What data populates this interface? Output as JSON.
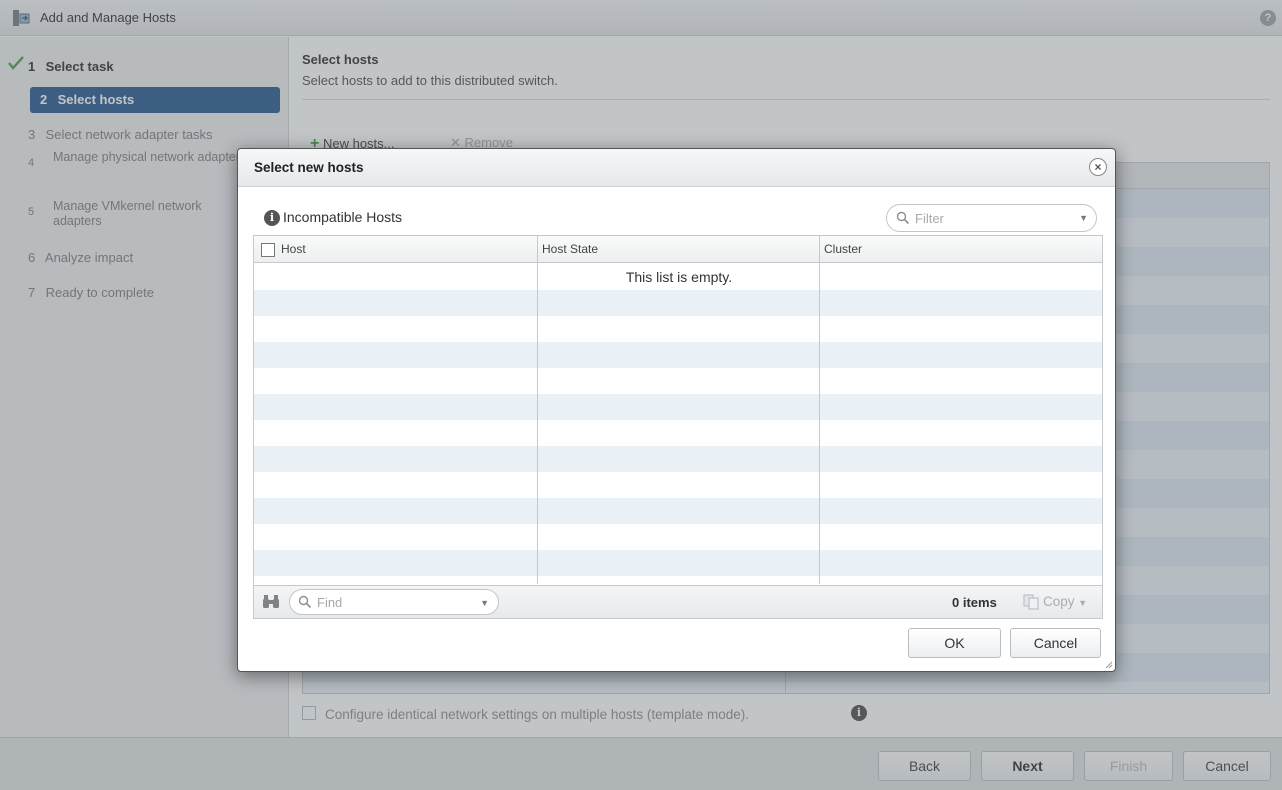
{
  "window": {
    "title": "Add and Manage Hosts",
    "help_icon": "help-icon",
    "help_glyph": "?"
  },
  "steps": [
    {
      "num": "1",
      "label": "Select task",
      "state": "done"
    },
    {
      "num": "2",
      "label": "Select hosts",
      "state": "active"
    },
    {
      "num": "3",
      "label": "Select network adapter tasks",
      "state": "pending"
    },
    {
      "num": "4",
      "label": "Manage physical network adapters",
      "state": "pending"
    },
    {
      "num": "5",
      "label": "Manage VMkernel network adapters",
      "state": "pending"
    },
    {
      "num": "6",
      "label": "Analyze impact",
      "state": "pending"
    },
    {
      "num": "7",
      "label": "Ready to complete",
      "state": "pending"
    }
  ],
  "content": {
    "title": "Select hosts",
    "description": "Select hosts to add to this distributed switch.",
    "new_hosts_label": "New hosts...",
    "remove_label": "Remove",
    "template_mode_label": "Configure identical network settings on multiple hosts (template mode).",
    "template_mode_checked": false
  },
  "footer": {
    "back_label": "Back",
    "next_label": "Next",
    "finish_label": "Finish",
    "cancel_label": "Cancel"
  },
  "dialog": {
    "title": "Select new hosts",
    "close_glyph": "×",
    "incompatible_hosts_label": "Incompatible Hosts",
    "filter_placeholder": "Filter",
    "columns": [
      "Host",
      "Host State",
      "Cluster"
    ],
    "rows": [],
    "empty_message": "This list is empty.",
    "find_placeholder": "Find",
    "item_count": "0 items",
    "copy_label": "Copy",
    "ok_label": "OK",
    "cancel_label": "Cancel"
  },
  "colors": {
    "active_step": "#1a4f8b",
    "check_green": "#3c9a2f",
    "add_green": "#2e9a3a"
  }
}
